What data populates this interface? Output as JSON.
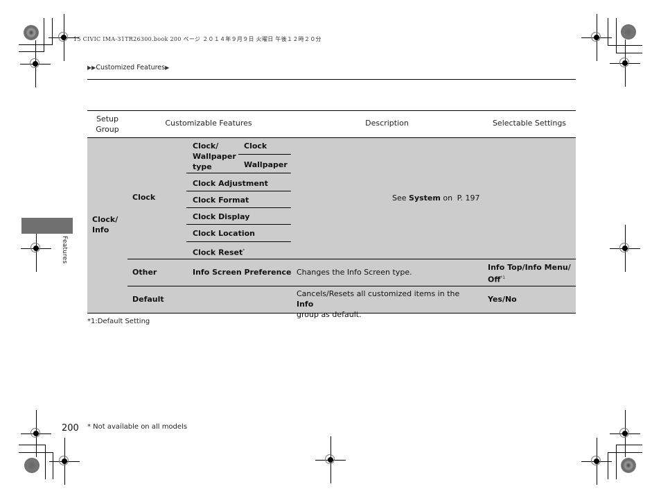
{
  "print_header": "15 CIVIC IMA-31TR26300.book  200 ページ  ２０１４年９月９日  火曜日  午後１２時２０分",
  "breadcrumb": {
    "prefix_icon": "double-triangle-right-icon",
    "label": "Customized Features",
    "suffix_icon": "triangle-right-icon"
  },
  "section_tab": {
    "label": "Features",
    "color": "#707070"
  },
  "table": {
    "headers": [
      "Setup Group",
      "Customizable Features",
      "Description",
      "Selectable Settings"
    ],
    "setup_group": "Clock/ Info",
    "rows": {
      "clock": {
        "group": "Clock",
        "wallpaper_type_label": "Clock/ Wallpaper type",
        "wallpaper_options": [
          "Clock",
          "Wallpaper"
        ],
        "features": [
          "Clock Adjustment",
          "Clock Format",
          "Clock Display",
          "Clock Location",
          "Clock Reset"
        ],
        "clock_reset_marker": "*",
        "description_prefix": "See",
        "description_bold": "System",
        "description_mid": "on",
        "description_ref": "P. 197"
      },
      "other": {
        "group": "Other",
        "feature": "Info Screen Preference",
        "description": "Changes the Info Screen type.",
        "settings_line1": "Info Top/Info Menu/",
        "settings_line2": "Off",
        "settings_marker": "*1"
      },
      "default": {
        "group": "Default",
        "description_prefix": "Cancels/Resets all customized items in the",
        "description_bold": "Info",
        "description_suffix": "group as default.",
        "settings": "Yes/No"
      }
    },
    "background_color": "#cccccc"
  },
  "footnote_default": "*1:Default Setting",
  "page_number": "200",
  "availability_note": "* Not available on all models"
}
